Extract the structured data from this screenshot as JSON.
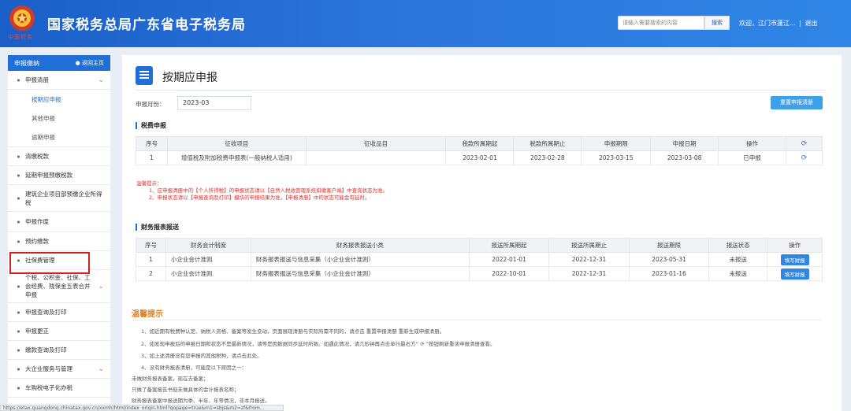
{
  "header": {
    "emblem_text": "中国税务",
    "title": "国家税务总局广东省电子税务局",
    "search_placeholder": "请输入需要搜索的内容",
    "search_button": "搜索",
    "user_greeting": "欢迎，江门市蓬江...",
    "separator": "|",
    "logout": "退出"
  },
  "sidebar": {
    "head_label": "申报缴纳",
    "back_label": "返回主页",
    "items": [
      {
        "label": "申报清册",
        "expandable": true
      },
      {
        "label": "按期应申报",
        "sub": true,
        "active": true
      },
      {
        "label": "其他申报",
        "sub": true
      },
      {
        "label": "逾期申报",
        "sub": true
      },
      {
        "label": "清缴税款"
      },
      {
        "label": "延期申报预缴税款"
      },
      {
        "label": "建筑企业项目部预缴企业所得税"
      },
      {
        "label": "申报作废"
      },
      {
        "label": "预约缴款"
      },
      {
        "label": "社保费管理"
      },
      {
        "label": "个税、公积金、社保、工会经费、残保金五表合并申报",
        "expandable": true
      },
      {
        "label": "申报查询及打印"
      },
      {
        "label": "申报更正"
      },
      {
        "label": "缴款查询及打印"
      },
      {
        "label": "大企业服务与管理",
        "expandable": true
      },
      {
        "label": "车购税电子化办税"
      }
    ]
  },
  "main": {
    "page_title": "按期应申报",
    "month_label": "申报月份：",
    "month_value": "2023-03",
    "reset_button": "重置申报清册",
    "tax_section": "税费申报",
    "tax_table": {
      "headers": [
        "序号",
        "征收项目",
        "征收品目",
        "税款所属期起",
        "税款所属期止",
        "申报期限",
        "申报日期",
        "操作"
      ],
      "rows": [
        [
          "1",
          "增值税及附加税费申报表(一般纳税人适用)",
          "",
          "2023-02-01",
          "2023-02-28",
          "2023-03-15",
          "2023-03-08",
          "已申报"
        ]
      ]
    },
    "warn_title": "温馨提示：",
    "warn_lines": [
      "1、应申报清册中的【个人所得税】的申报状态请以【自然人税收管理系统扣缴客户端】中查询状态为准。",
      "2、申报状态请以【申报查询及打印】模块的申报结果为准，【申报清册】中的状态可能会有延时。"
    ],
    "fin_section": "财务报表报送",
    "fin_table": {
      "headers": [
        "序号",
        "财务会计制度",
        "财务报表报送小类",
        "报送所属期起",
        "报送所属期止",
        "报送期限",
        "报送状态",
        "操作"
      ],
      "rows": [
        [
          "1",
          "小企业会计准则",
          "财务报表报送与信息采集（小企业会计准则）",
          "2022-01-01",
          "2022-12-31",
          "2023-05-31",
          "未报送",
          "填写财报"
        ],
        [
          "2",
          "小企业会计准则",
          "财务报表报送与信息采集（小企业会计准则）",
          "2022-10-01",
          "2022-12-31",
          "2023-01-16",
          "未报送",
          "填写财报"
        ]
      ]
    },
    "tips_title": "温馨提示",
    "tips": [
      "1、如近期有税费种认定、纳税人资格、备案等发生变动，页面展现清册与实际所需不同的，请点击 重置申报清册 重新生成申报清册。",
      "2、如发现申报后的申报日期和状态不是最新情况，请等是因数据同步延时所致。如遇此情况，请几秒钟再点击单行最右方“ ⟳ ”按钮刷新重读申报清册查看。",
      "3、如上述清册没有您申报的其他税种，请点击此处。",
      "4、没有财务报表清册，可能是以下原因之一：",
      "未做财务报表备案，现在去备案；",
      "只做了备案报告书但未做具体的会计报表名称；",
      "财务报表备案中报送期为季、半年、年等情况，非本月报送。"
    ]
  },
  "statusbar": "https://etax.guangdong.chinatax.gov.cn/xxmh/html/index_origin.html?gopage=true&m1=sbjs&m2=zf&from..."
}
